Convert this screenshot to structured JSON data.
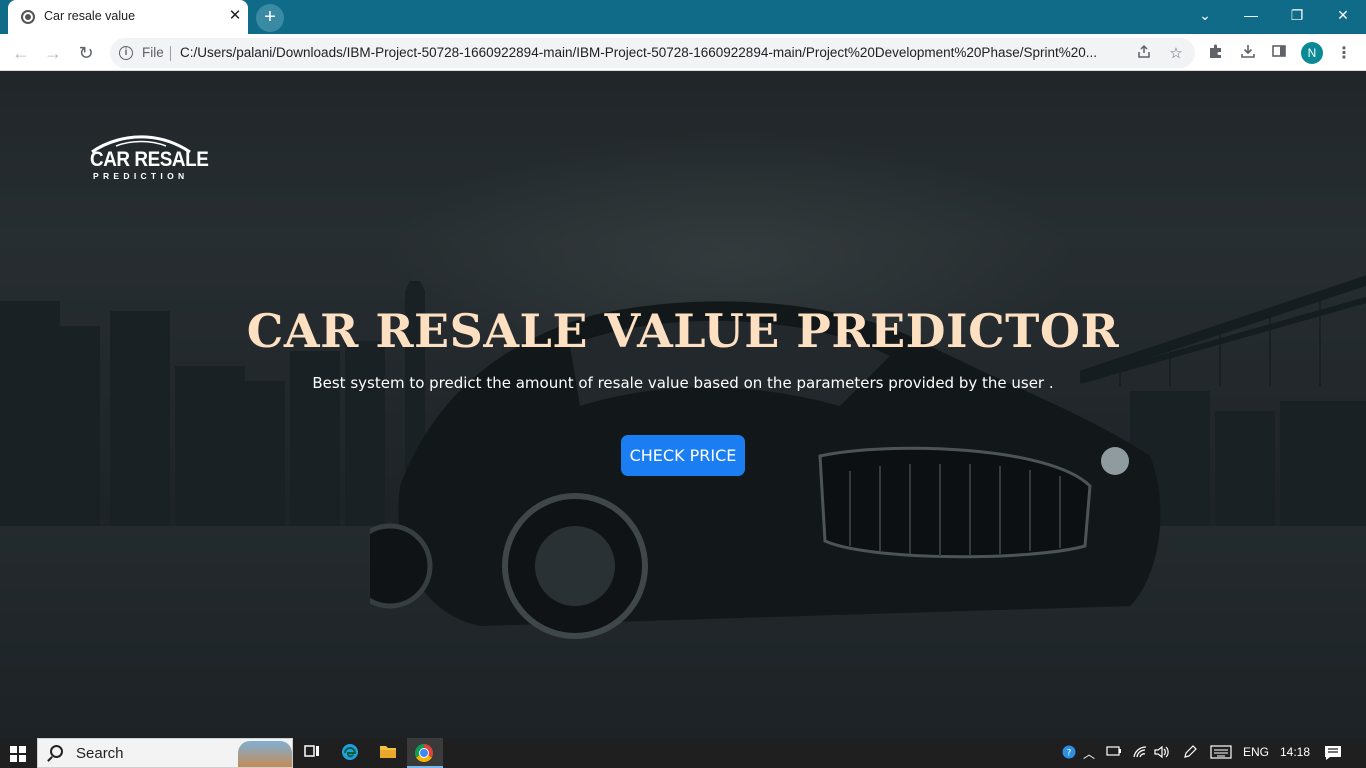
{
  "browser": {
    "tab_title": "Car resale value",
    "tab_close": "✕",
    "new_tab": "+",
    "window_controls": {
      "dropdown": "⌄",
      "minimize": "—",
      "restore": "❐",
      "close": "✕"
    },
    "nav": {
      "back": "←",
      "forward": "→",
      "reload": "↻"
    },
    "address": {
      "scheme_label": "File",
      "url": "C:/Users/palani/Downloads/IBM-Project-50728-1660922894-main/IBM-Project-50728-1660922894-main/Project%20Development%20Phase/Sprint%20..."
    },
    "profile_initial": "N",
    "icons": [
      "info-icon",
      "share-icon",
      "star-icon",
      "extensions-icon",
      "download-icon",
      "side-panel-icon",
      "profile-icon",
      "menu-icon"
    ]
  },
  "page": {
    "logo": {
      "title": "CAR RESALE",
      "subtitle": "PREDICTION"
    },
    "hero": {
      "title": "CAR RESALE VALUE PREDICTOR",
      "subtitle": "Best system to predict the amount of resale value based on the parameters provided by the user .",
      "cta_label": "CHECK PRICE"
    },
    "colors": {
      "title": "#fde0c1",
      "cta": "#1a7ef2"
    }
  },
  "taskbar": {
    "search_placeholder": "Search",
    "language": "ENG",
    "time": "14:18",
    "pinned": [
      "task-view-icon",
      "edge-icon",
      "file-explorer-icon",
      "chrome-icon"
    ]
  }
}
